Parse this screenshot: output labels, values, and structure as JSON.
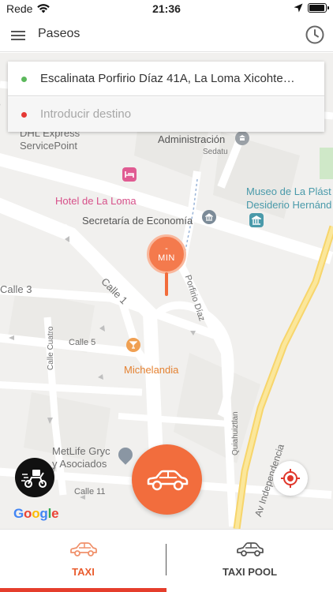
{
  "status_bar": {
    "carrier": "Rede",
    "time": "21:36",
    "battery_level": 0.95
  },
  "nav": {
    "title": "Paseos",
    "menu_icon": "hamburger-icon",
    "history_icon": "clock-icon"
  },
  "address": {
    "origin": "Escalinata Porfirio Díaz 41A, La Loma Xicohte…",
    "destination_placeholder": "Introducir destino",
    "origin_color": "#5cb85c",
    "destination_color": "#e53935"
  },
  "map": {
    "labels": {
      "dhl": "DHL Express",
      "servicepoint": "ServicePoint",
      "administracion": "Administración",
      "sedatu": "Sedatu",
      "hotel": "Hotel de La Loma",
      "museo_line1": "Museo de La Plást",
      "museo_line2": "Desiderio Hernánd",
      "secretaria": "Secretaría de Economía",
      "porfirio_diaz": "Porfirio Díaz",
      "calle3": "Calle 3",
      "calle1": "Calle 1",
      "calle_cuatro": "Calle Cuatro",
      "calle5": "Calle 5",
      "michelandia": "Michelandia",
      "quiahuiztlan": "Quiahuiztlan",
      "av_independencia": "Av Independencia",
      "metlife_line1": "MetLife Gryc",
      "metlife_line2": "y Asociados",
      "calle11": "Calle 11",
      "edge_era": "era"
    },
    "pin": {
      "dash": "-",
      "unit": "MIN"
    },
    "google": [
      "G",
      "o",
      "o",
      "g",
      "l",
      "e"
    ]
  },
  "buttons": {
    "delivery_icon": "delivery-scooter-icon",
    "request_icon": "car-icon",
    "locate_icon": "crosshair-icon"
  },
  "tabs": [
    {
      "label": "TAXI",
      "icon": "car-outline-icon",
      "active": true,
      "color": "#e95c2e"
    },
    {
      "label": "TAXI POOL",
      "icon": "car-outline-icon",
      "active": false,
      "color": "#444444"
    }
  ],
  "colors": {
    "accent": "#f26d3d",
    "active_indicator": "#e53e2c"
  }
}
